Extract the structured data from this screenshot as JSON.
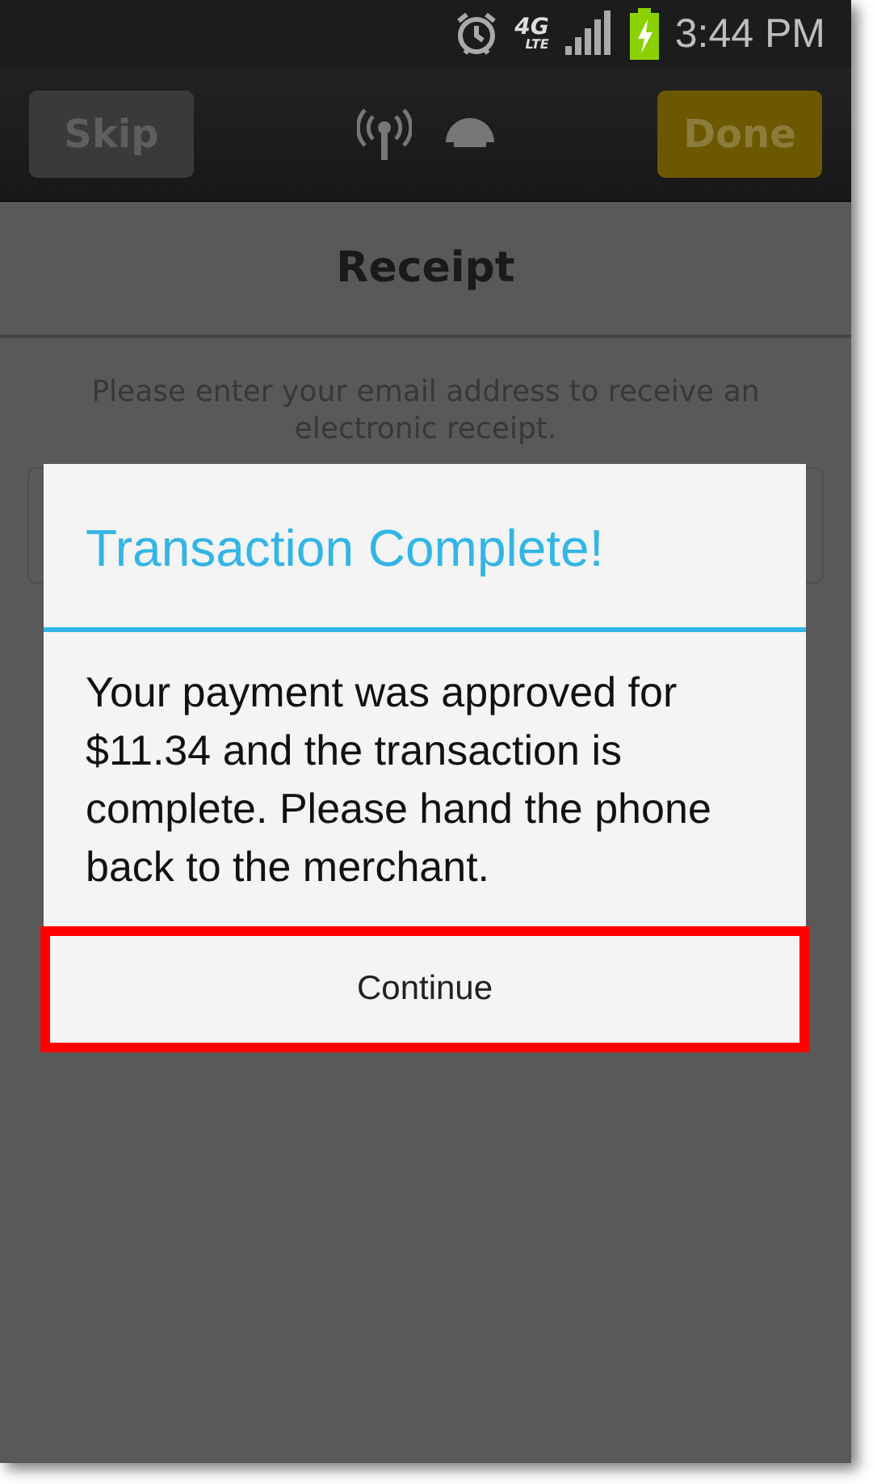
{
  "status_bar": {
    "network_type": "4G",
    "network_subtype": "LTE",
    "time": "3:44 PM"
  },
  "action_bar": {
    "left_button": "Skip",
    "right_button": "Done"
  },
  "screen": {
    "title": "Receipt",
    "instructions": "Please enter your email address to receive an electronic receipt."
  },
  "dialog": {
    "title": "Transaction Complete!",
    "message": "Your payment was approved for $11.34 and the transaction is complete. Please hand the phone back to the merchant.",
    "button": {
      "label": "Continue",
      "highlighted": true
    }
  }
}
